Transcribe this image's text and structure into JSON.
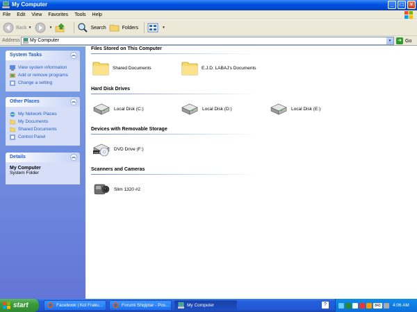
{
  "window": {
    "title": "My Computer"
  },
  "menu": [
    "File",
    "Edit",
    "View",
    "Favorites",
    "Tools",
    "Help"
  ],
  "toolbar": {
    "back": "Back",
    "search": "Search",
    "folders": "Folders"
  },
  "address": {
    "label": "Address",
    "value": "My Computer",
    "go": "Go"
  },
  "left": {
    "system_tasks": {
      "title": "System Tasks",
      "items": [
        "View system information",
        "Add or remove programs",
        "Change a setting"
      ]
    },
    "other_places": {
      "title": "Other Places",
      "items": [
        "My Network Places",
        "My Documents",
        "Shared Documents",
        "Control Panel"
      ]
    },
    "details": {
      "title": "Details",
      "name": "My Computer",
      "type": "System Folder"
    }
  },
  "main": {
    "groups": [
      {
        "title": "Files Stored on This Computer",
        "items": [
          "Shared Documents",
          "E.J.D. LABAJ's Documents"
        ]
      },
      {
        "title": "Hard Disk Drives",
        "items": [
          "Local Disk (C:)",
          "Local Disk (D:)",
          "Local Disk (E:)"
        ]
      },
      {
        "title": "Devices with Removable Storage",
        "items": [
          "DVD Drive (F:)"
        ]
      },
      {
        "title": "Scanners and Cameras",
        "items": [
          "Slim 1320 #2"
        ]
      }
    ]
  },
  "taskbar": {
    "start": "start",
    "tasks": [
      "Facebook | Kol Fraku...",
      "Forumi Shqiptar - Pos...",
      "My Computer"
    ],
    "tray_badge": "843",
    "clock": "4:06 AM"
  },
  "colors": {
    "titlebar": "#0054e3",
    "leftpane": "#6f8fe0",
    "link": "#215dc6",
    "start": "#3c9a3c"
  },
  "icons": [
    "folder-icon",
    "hard-disk-icon",
    "dvd-drive-icon",
    "camera-icon",
    "search-icon",
    "back-icon",
    "forward-icon",
    "up-folder-icon",
    "views-icon"
  ]
}
